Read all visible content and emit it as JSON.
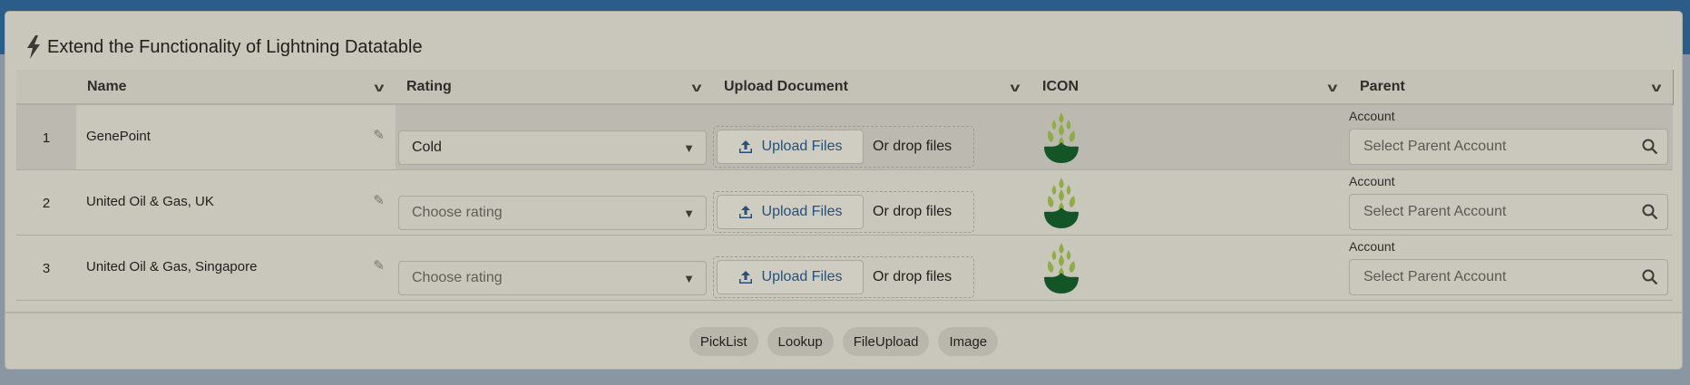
{
  "title": "Extend the Functionality of Lightning Datatable",
  "columns": [
    "Name",
    "Rating",
    "Upload Document",
    "ICON",
    "Parent"
  ],
  "rows": [
    {
      "num": "1",
      "name": "GenePoint",
      "rating": "Cold",
      "upload": "Upload Files",
      "drop": "Or drop files",
      "parent_label": "Account",
      "parent_placeholder": "Select Parent Account"
    },
    {
      "num": "2",
      "name": "United Oil & Gas, UK",
      "rating": "Choose rating",
      "upload": "Upload Files",
      "drop": "Or drop files",
      "parent_label": "Account",
      "parent_placeholder": "Select Parent Account"
    },
    {
      "num": "3",
      "name": "United Oil & Gas, Singapore",
      "rating": "Choose rating",
      "upload": "Upload Files",
      "drop": "Or drop files",
      "parent_label": "Account",
      "parent_placeholder": "Select Parent Account"
    }
  ],
  "footer_buttons": [
    "PickList",
    "Lookup",
    "FileUpload",
    "Image"
  ],
  "colors": {
    "accent": "#24507e",
    "background": "#2c5d88",
    "card": "#c9c7bb"
  }
}
